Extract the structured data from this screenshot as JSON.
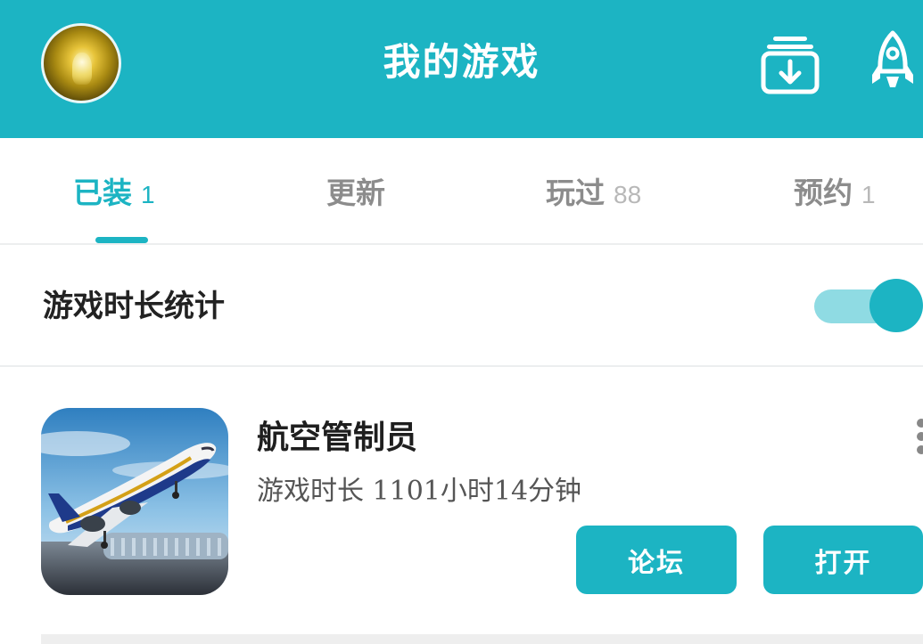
{
  "header": {
    "title": "我的游戏",
    "background_color": "#1cb4c3",
    "avatar_icon": "user-avatar",
    "download_icon": "download-manager-icon",
    "rocket_icon": "rocket-icon"
  },
  "tabs": [
    {
      "label": "已装",
      "count": "1",
      "active": true
    },
    {
      "label": "更新",
      "count": "",
      "active": false
    },
    {
      "label": "玩过",
      "count": "88",
      "active": false
    },
    {
      "label": "预约",
      "count": "1",
      "active": false
    }
  ],
  "stats": {
    "label": "游戏时长统计",
    "toggle_on": true
  },
  "games": [
    {
      "name": "航空管制员",
      "playtime": "游戏时长 1101小时14分钟",
      "icon": "airplane-game-icon",
      "forum_label": "论坛",
      "open_label": "打开",
      "more_icon": "more-vertical-icon"
    }
  ],
  "colors": {
    "accent": "#1cb4c3",
    "toggle_track": "#8fdbe3",
    "inactive_tab": "#8c8c8c"
  }
}
